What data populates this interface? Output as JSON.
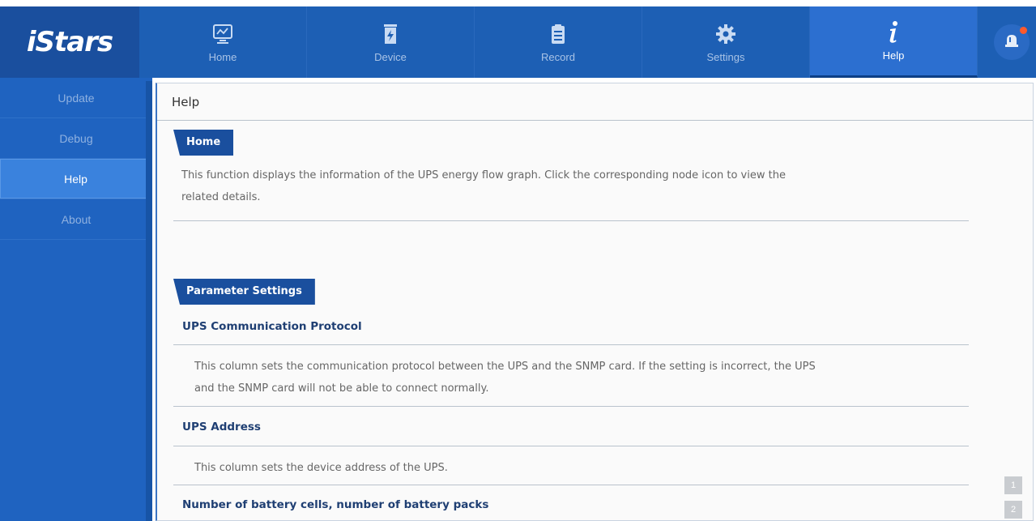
{
  "app": {
    "logo": "iStars"
  },
  "nav": [
    {
      "label": "Home",
      "icon": "monitor-chart-icon"
    },
    {
      "label": "Device",
      "icon": "battery-device-icon"
    },
    {
      "label": "Record",
      "icon": "clipboard-record-icon"
    },
    {
      "label": "Settings",
      "icon": "gear-icon"
    },
    {
      "label": "Help",
      "icon": "info-icon",
      "active": true
    }
  ],
  "alarm": {
    "icon": "alarm-bell-icon",
    "has_notification": true
  },
  "sidebar": {
    "items": [
      {
        "label": "Update"
      },
      {
        "label": "Debug"
      },
      {
        "label": "Help",
        "active": true
      },
      {
        "label": "About"
      }
    ]
  },
  "main": {
    "title": "Help",
    "home_section": {
      "tag": "Home",
      "text_line1": "This function displays the information of the UPS energy flow graph. Click the corresponding node icon to view the",
      "text_line2": "related details."
    },
    "param_section": {
      "tag": "Parameter Settings",
      "items": [
        {
          "title": "UPS Communication Protocol",
          "text_line1": "This column sets the communication protocol between the UPS and the SNMP card. If the setting is incorrect, the UPS",
          "text_line2": "and the SNMP card will not be able to connect normally."
        },
        {
          "title": "UPS Address",
          "text_line1": "This column sets the device address of the UPS."
        },
        {
          "title": "Number of battery cells, number of battery packs"
        }
      ]
    }
  },
  "pager": [
    "1",
    "2"
  ],
  "colors": {
    "topbar": "#1d5fb4",
    "sidebar": "#1f63c0",
    "active": "#2c6fd0",
    "tag": "#1a4f9e",
    "subhead": "#1f3f73"
  }
}
